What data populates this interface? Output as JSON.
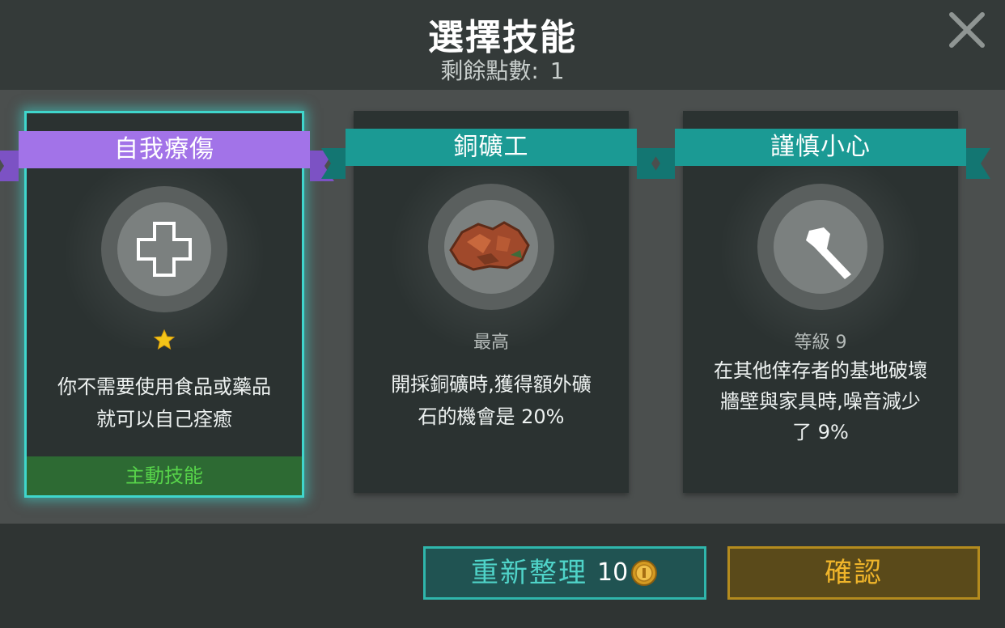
{
  "header": {
    "title": "選擇技能",
    "points_label": "剩餘點數:",
    "points_value": "1"
  },
  "cards": [
    {
      "name": "自我療傷",
      "level_text": "",
      "description_lines": [
        "你不需要使用食品或藥品",
        "就可以自己痊癒"
      ],
      "active_label": "主動技能",
      "ribbon_color": "#a273e8",
      "icon": "medical-cross-icon",
      "rank_icon": "star-icon"
    },
    {
      "name": "銅礦工",
      "level_text": "最高",
      "description_lines": [
        "開採銅礦時,獲得額外礦",
        "石的機會是 20%"
      ],
      "ribbon_color": "#1b9a94",
      "icon": "copper-ore-icon"
    },
    {
      "name": "謹慎小心",
      "level_text": "等級 9",
      "description_lines": [
        "在其他倖存者的基地破壞",
        "牆壁與家具時,噪音減少",
        "了 9%"
      ],
      "ribbon_color": "#1b9a94",
      "icon": "axe-icon"
    }
  ],
  "buttons": {
    "refresh_label": "重新整理",
    "refresh_cost": "10",
    "confirm_label": "確認"
  },
  "colors": {
    "accent_teal": "#3fd6cc",
    "confirm_gold": "#f0b52a",
    "active_green": "#57d34a"
  }
}
